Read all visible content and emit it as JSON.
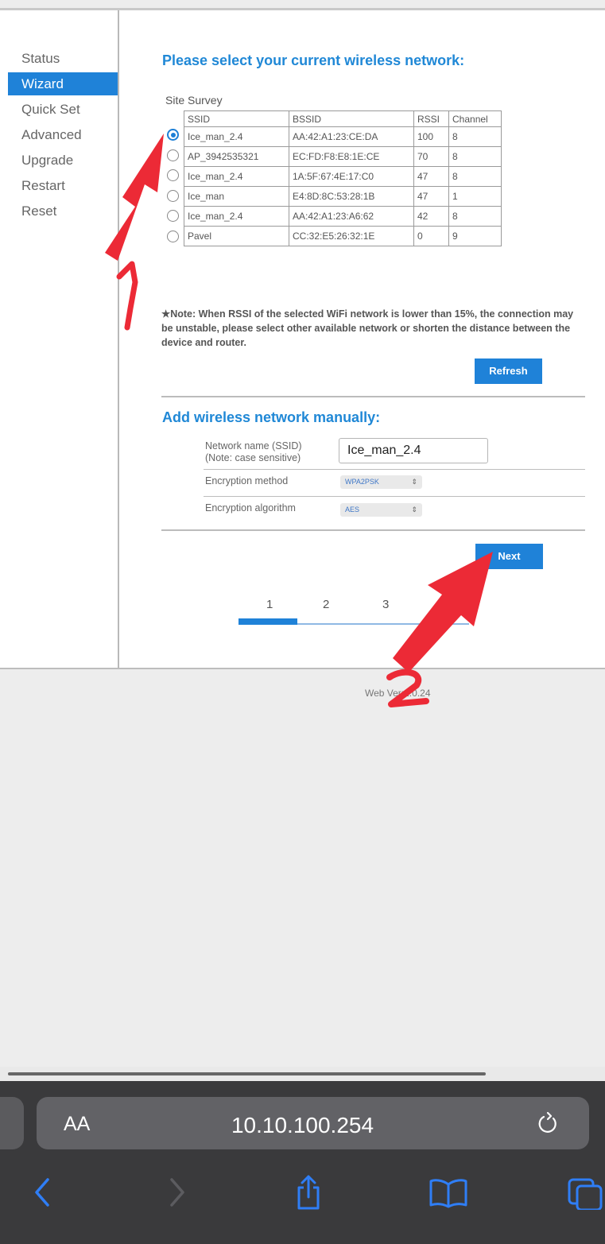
{
  "sidebar": {
    "items": [
      {
        "label": "Status"
      },
      {
        "label": "Wizard"
      },
      {
        "label": "Quick Set"
      },
      {
        "label": "Advanced"
      },
      {
        "label": "Upgrade"
      },
      {
        "label": "Restart"
      },
      {
        "label": "Reset"
      }
    ],
    "active": "Wizard"
  },
  "survey": {
    "heading": "Please select your current wireless network:",
    "label": "Site Survey",
    "columns": [
      "SSID",
      "BSSID",
      "RSSI",
      "Channel"
    ],
    "rows": [
      {
        "ssid": "Ice_man_2.4",
        "bssid": "AA:42:A1:23:CE:DA",
        "rssi": "100",
        "channel": "8",
        "selected": true
      },
      {
        "ssid": "AP_3942535321",
        "bssid": "EC:FD:F8:E8:1E:CE",
        "rssi": "70",
        "channel": "8",
        "selected": false
      },
      {
        "ssid": "Ice_man_2.4",
        "bssid": "1A:5F:67:4E:17:C0",
        "rssi": "47",
        "channel": "8",
        "selected": false
      },
      {
        "ssid": "Ice_man",
        "bssid": "E4:8D:8C:53:28:1B",
        "rssi": "47",
        "channel": "1",
        "selected": false
      },
      {
        "ssid": "Ice_man_2.4",
        "bssid": "AA:42:A1:23:A6:62",
        "rssi": "42",
        "channel": "8",
        "selected": false
      },
      {
        "ssid": "Pavel",
        "bssid": "CC:32:E5:26:32:1E",
        "rssi": "0",
        "channel": "9",
        "selected": false
      }
    ],
    "note": "★Note: When RSSI of the selected WiFi network is lower than 15%, the connection may be unstable, please select other available network or shorten the distance between the device and router.",
    "refresh_label": "Refresh"
  },
  "manual": {
    "heading": "Add wireless network manually:",
    "ssid_label_1": "Network name (SSID)",
    "ssid_label_2": "(Note: case sensitive)",
    "ssid_value": "Ice_man_2.4",
    "enc_method_label": "Encryption method",
    "enc_method_value": "WPA2PSK",
    "enc_alg_label": "Encryption algorithm",
    "enc_alg_value": "AES",
    "next_label": "Next"
  },
  "steps": {
    "labels": [
      "1",
      "2",
      "3"
    ],
    "current": "1"
  },
  "footer": {
    "web_version": "Web Ver:1.0.24"
  },
  "annotations": {
    "marker_1": "1",
    "marker_2": "2"
  },
  "browser": {
    "text_size_label": "AA",
    "url": "10.10.100.254"
  },
  "colors": {
    "accent": "#1f82d8",
    "annotation": "#ec2a36",
    "browser_bar": "#3a3a3c"
  }
}
